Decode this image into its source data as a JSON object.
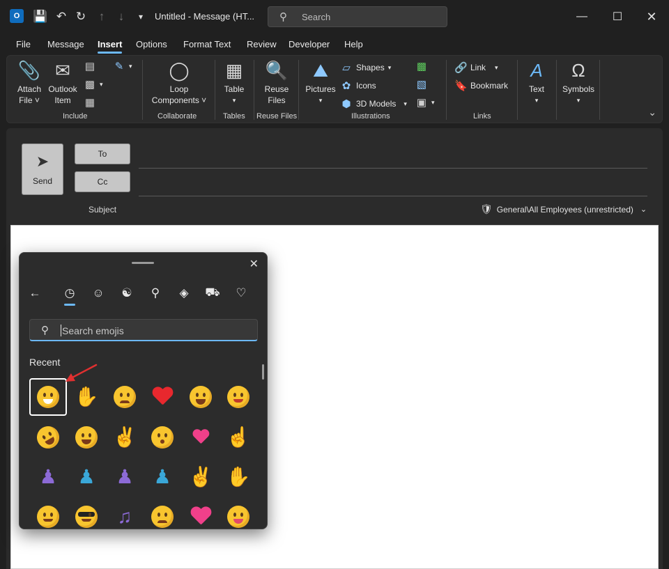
{
  "titlebar": {
    "title": "Untitled  -  Message (HT...",
    "search_placeholder": "Search",
    "app_logo": "O"
  },
  "menu": {
    "tabs": [
      "File",
      "Message",
      "Insert",
      "Options",
      "Format Text",
      "Review",
      "Developer",
      "Help"
    ],
    "active": "Insert"
  },
  "ribbon": {
    "attach_file": "Attach\nFile",
    "attach_file_l1": "Attach",
    "attach_file_l2": "File ˅",
    "outlook_item_l1": "Outlook",
    "outlook_item_l2": "Item",
    "loop_l1": "Loop",
    "loop_l2": "Components ˅",
    "table": "Table",
    "reuse_l1": "Reuse",
    "reuse_l2": "Files",
    "pictures": "Pictures",
    "shapes": "Shapes",
    "icons": "Icons",
    "models": "3D Models",
    "link": "Link",
    "bookmark": "Bookmark",
    "text": "Text",
    "symbols": "Symbols",
    "groups": [
      "Include",
      "Collaborate",
      "Tables",
      "Reuse Files",
      "Illustrations",
      "Links"
    ]
  },
  "compose": {
    "send": "Send",
    "to": "To",
    "cc": "Cc",
    "subject": "Subject",
    "sensitivity": "General\\All Employees (unrestricted)"
  },
  "emoji_panel": {
    "search_placeholder": "Search emojis",
    "section": "Recent",
    "tabs": [
      "back-arrow",
      "recent",
      "smiley",
      "kaomoji",
      "symbols",
      "gif",
      "car",
      "heart"
    ]
  }
}
